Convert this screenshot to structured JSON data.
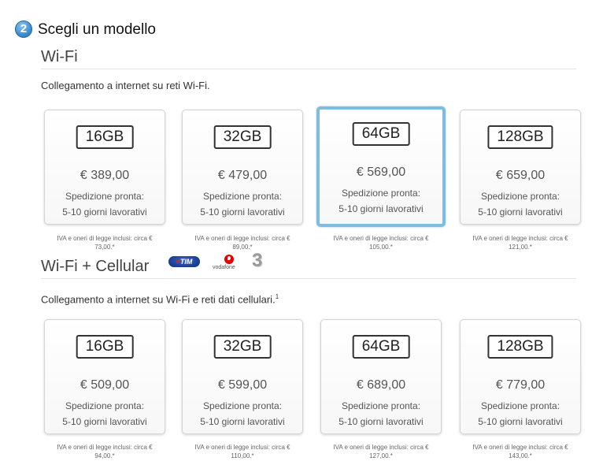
{
  "step": {
    "number": "2",
    "title": "Scegli un modello"
  },
  "wifi": {
    "title": "Wi-Fi",
    "description": "Collegamento a internet su reti Wi-Fi.",
    "models": [
      {
        "capacity": "16GB",
        "price": "€ 389,00",
        "ship1": "Spedizione pronta:",
        "ship2": "5-10 giorni lavorativi",
        "vat1": "IVA e oneri di legge inclusi: circa €",
        "vat2": "73,00.*",
        "selected": false
      },
      {
        "capacity": "32GB",
        "price": "€ 479,00",
        "ship1": "Spedizione pronta:",
        "ship2": "5-10 giorni lavorativi",
        "vat1": "IVA e oneri di legge inclusi: circa €",
        "vat2": "89,00.*",
        "selected": false
      },
      {
        "capacity": "64GB",
        "price": "€ 569,00",
        "ship1": "Spedizione pronta:",
        "ship2": "5-10 giorni lavorativi",
        "vat1": "IVA e oneri di legge inclusi: circa €",
        "vat2": "105,00.*",
        "selected": true
      },
      {
        "capacity": "128GB",
        "price": "€ 659,00",
        "ship1": "Spedizione pronta:",
        "ship2": "5-10 giorni lavorativi",
        "vat1": "IVA e oneri di legge inclusi: circa €",
        "vat2": "121,00.*",
        "selected": false
      }
    ]
  },
  "cellular": {
    "title": "Wi-Fi + Cellular",
    "description": "Collegamento a internet su Wi-Fi e reti dati cellulari.",
    "footnote": "1",
    "carriers": {
      "tim_a": "≡",
      "tim_b": "TIM",
      "vodafone": "vodafone",
      "three": "3"
    },
    "models": [
      {
        "capacity": "16GB",
        "price": "€ 509,00",
        "ship1": "Spedizione pronta:",
        "ship2": "5-10 giorni lavorativi",
        "vat1": "IVA e oneri di legge inclusi: circa €",
        "vat2": "94,00.*",
        "selected": false
      },
      {
        "capacity": "32GB",
        "price": "€ 599,00",
        "ship1": "Spedizione pronta:",
        "ship2": "5-10 giorni lavorativi",
        "vat1": "IVA e oneri di legge inclusi: circa €",
        "vat2": "110,00.*",
        "selected": false
      },
      {
        "capacity": "64GB",
        "price": "€ 689,00",
        "ship1": "Spedizione pronta:",
        "ship2": "5-10 giorni lavorativi",
        "vat1": "IVA e oneri di legge inclusi: circa €",
        "vat2": "127,00.*",
        "selected": false
      },
      {
        "capacity": "128GB",
        "price": "€ 779,00",
        "ship1": "Spedizione pronta:",
        "ship2": "5-10 giorni lavorativi",
        "vat1": "IVA e oneri di legge inclusi: circa €",
        "vat2": "143,00.*",
        "selected": false
      }
    ]
  },
  "colors": {
    "selected_border": "#7fbde0",
    "badge": "#3f8fd2"
  }
}
